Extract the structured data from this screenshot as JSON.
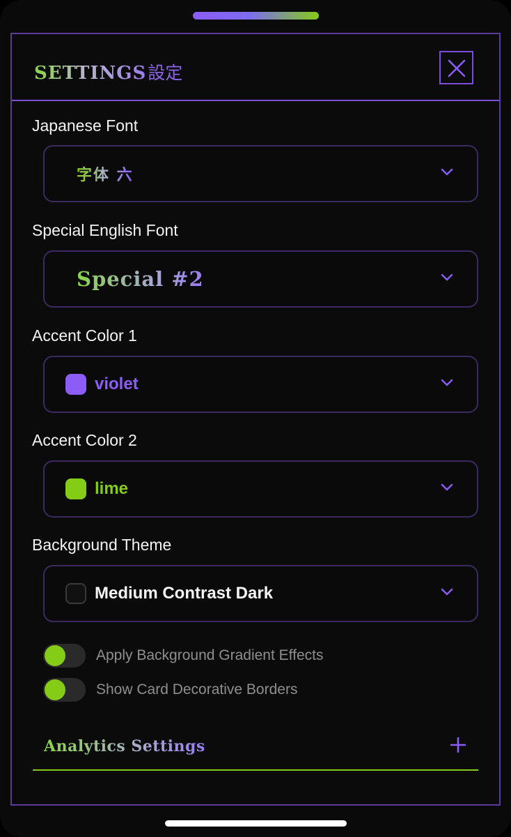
{
  "header": {
    "title_en": "SETTINGS",
    "title_jp": "設定"
  },
  "fields": {
    "japanese_font": {
      "label": "Japanese Font",
      "value": "字体 六"
    },
    "special_font": {
      "label": "Special English Font",
      "value": "Special #2"
    },
    "accent1": {
      "label": "Accent Color 1",
      "value": "violet",
      "color": "#8b5cf6"
    },
    "accent2": {
      "label": "Accent Color 2",
      "value": "lime",
      "color": "#84cc16"
    },
    "background": {
      "label": "Background Theme",
      "value": "Medium Contrast Dark",
      "color": "#111111"
    }
  },
  "toggles": [
    {
      "label": "Apply Background Gradient Effects",
      "on": true
    },
    {
      "label": "Show Card Decorative Borders",
      "on": true
    }
  ],
  "analytics": {
    "title": "Analytics Settings"
  },
  "icons": {
    "close": "close-icon",
    "chevron": "chevron-down-icon",
    "plus": "plus-icon"
  }
}
